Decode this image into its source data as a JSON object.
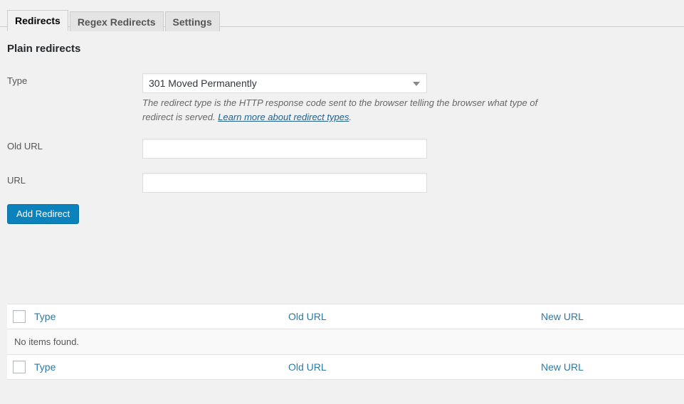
{
  "tabs": [
    {
      "label": "Redirects",
      "active": true
    },
    {
      "label": "Regex Redirects",
      "active": false
    },
    {
      "label": "Settings",
      "active": false
    }
  ],
  "page": {
    "heading": "Plain redirects"
  },
  "form": {
    "type": {
      "label": "Type",
      "selected_option": "301 Moved Permanently",
      "description_before": "The redirect type is the HTTP response code sent to the browser telling the browser what type of redirect is served. ",
      "description_link": "Learn more about redirect types",
      "description_after": "."
    },
    "old_url": {
      "label": "Old URL",
      "value": "",
      "placeholder": ""
    },
    "new_url": {
      "label": "URL",
      "value": "",
      "placeholder": ""
    },
    "submit_label": "Add Redirect"
  },
  "table": {
    "columns": {
      "select_all": "select-all-checkbox",
      "type": "Type",
      "old_url": "Old URL",
      "new_url": "New URL"
    },
    "empty_message": "No items found."
  },
  "colors": {
    "page_background": "#f1f1f1",
    "primary_button": "#0c82bd",
    "link": "#2e79a3",
    "heading": "#23282d"
  }
}
